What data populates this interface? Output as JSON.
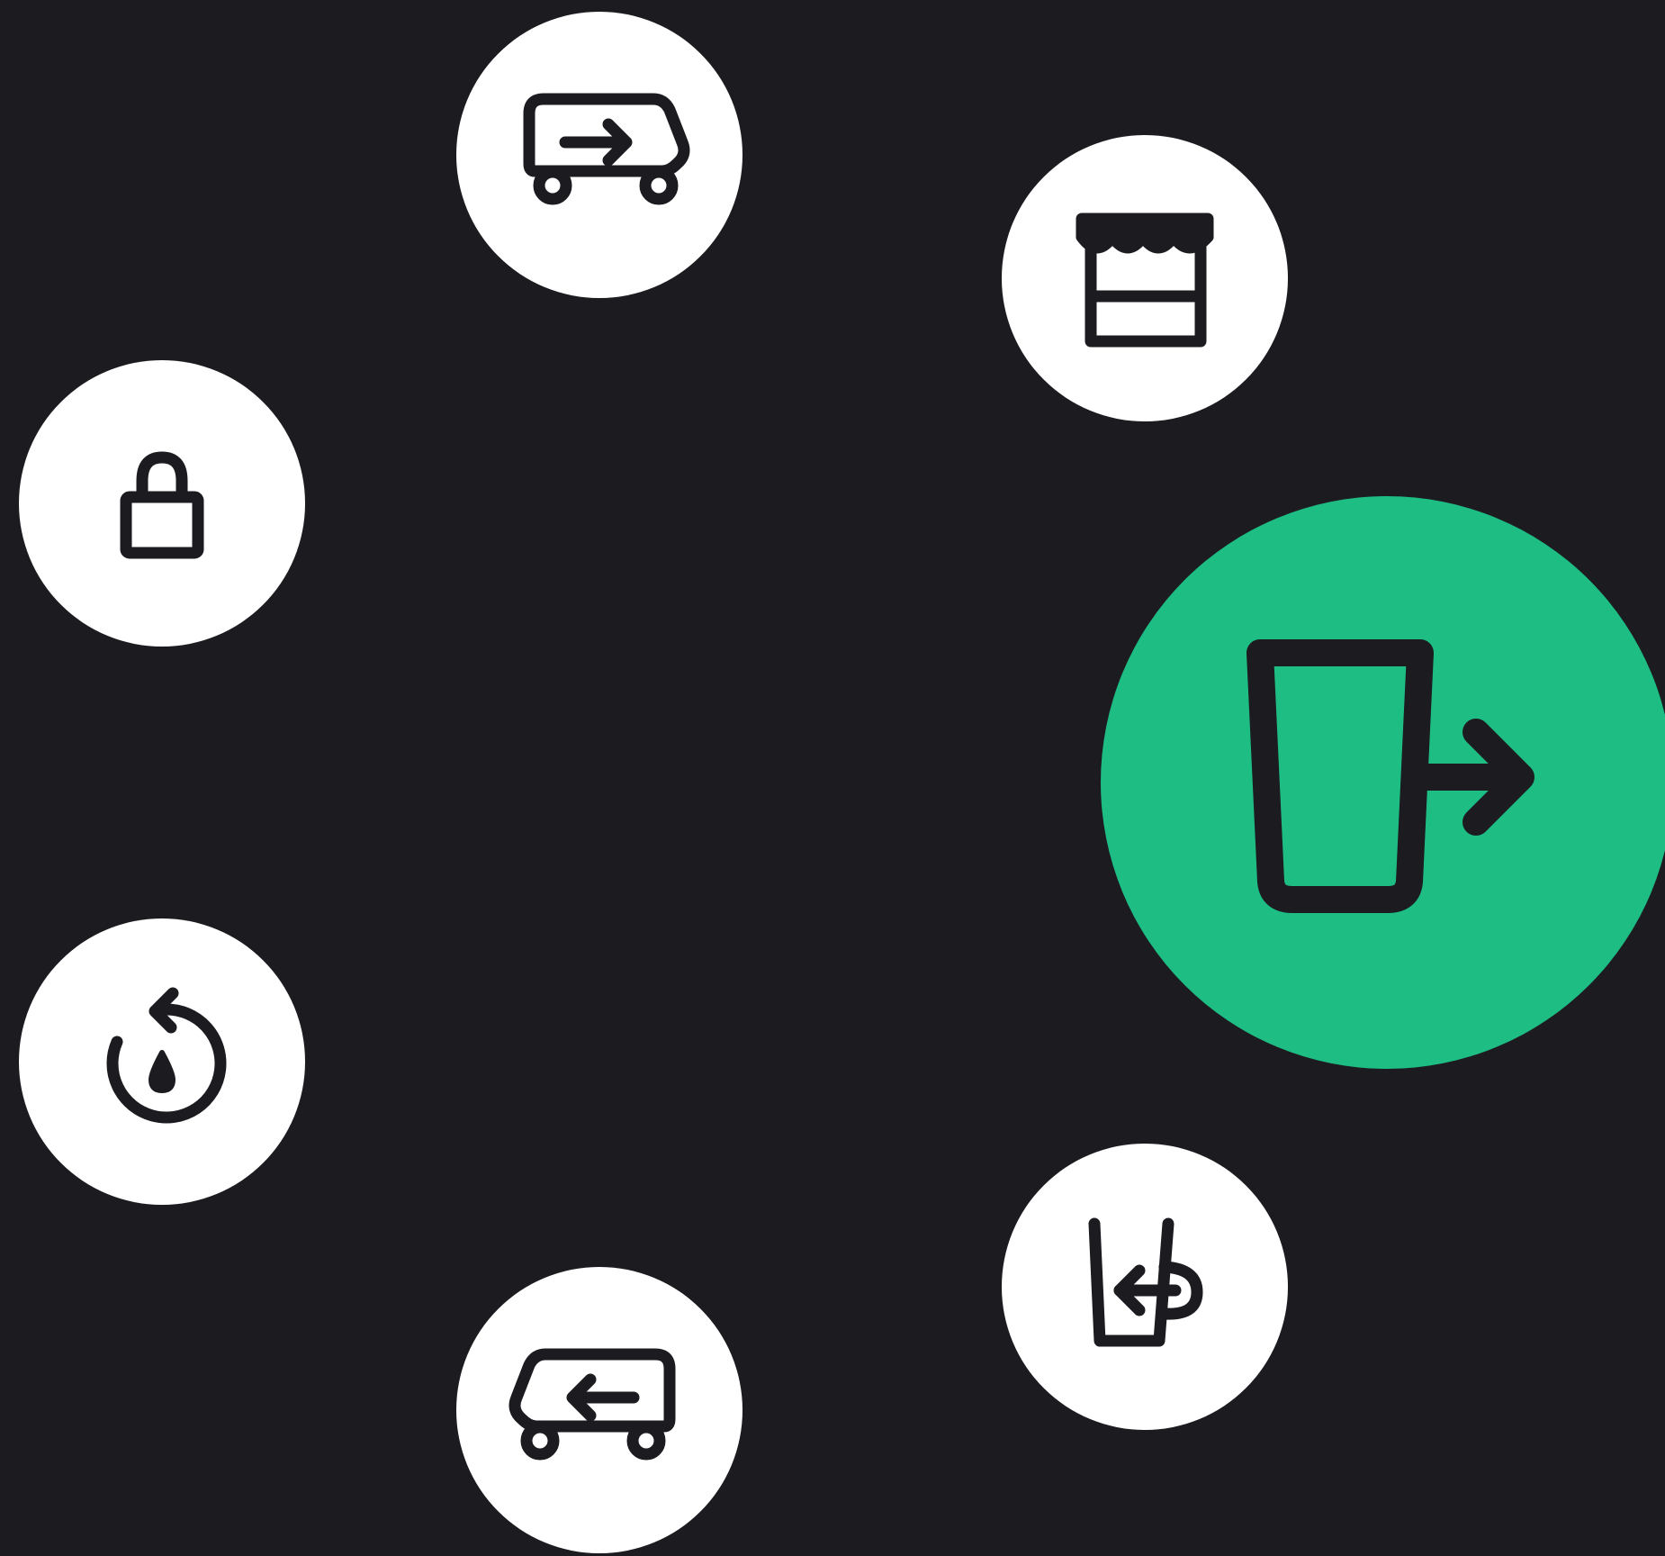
{
  "theme": {
    "background": "#1c1b20",
    "button_color": "#ffffff",
    "active_color": "#1dbd84",
    "icon_color": "#1c1b20"
  },
  "radial_menu": {
    "active_item": "cup-checkout",
    "items": [
      {
        "id": "van-out",
        "icon": "delivery-van-outbound-icon",
        "active": false
      },
      {
        "id": "stand",
        "icon": "market-stand-icon",
        "active": false
      },
      {
        "id": "lock",
        "icon": "padlock-icon",
        "active": false
      },
      {
        "id": "cup-checkout",
        "icon": "cup-checkout-arrow-icon",
        "active": true
      },
      {
        "id": "refill",
        "icon": "water-refill-cycle-icon",
        "active": false
      },
      {
        "id": "mug-return",
        "icon": "mug-return-icon",
        "active": false
      },
      {
        "id": "van-return",
        "icon": "delivery-van-return-icon",
        "active": false
      }
    ]
  }
}
